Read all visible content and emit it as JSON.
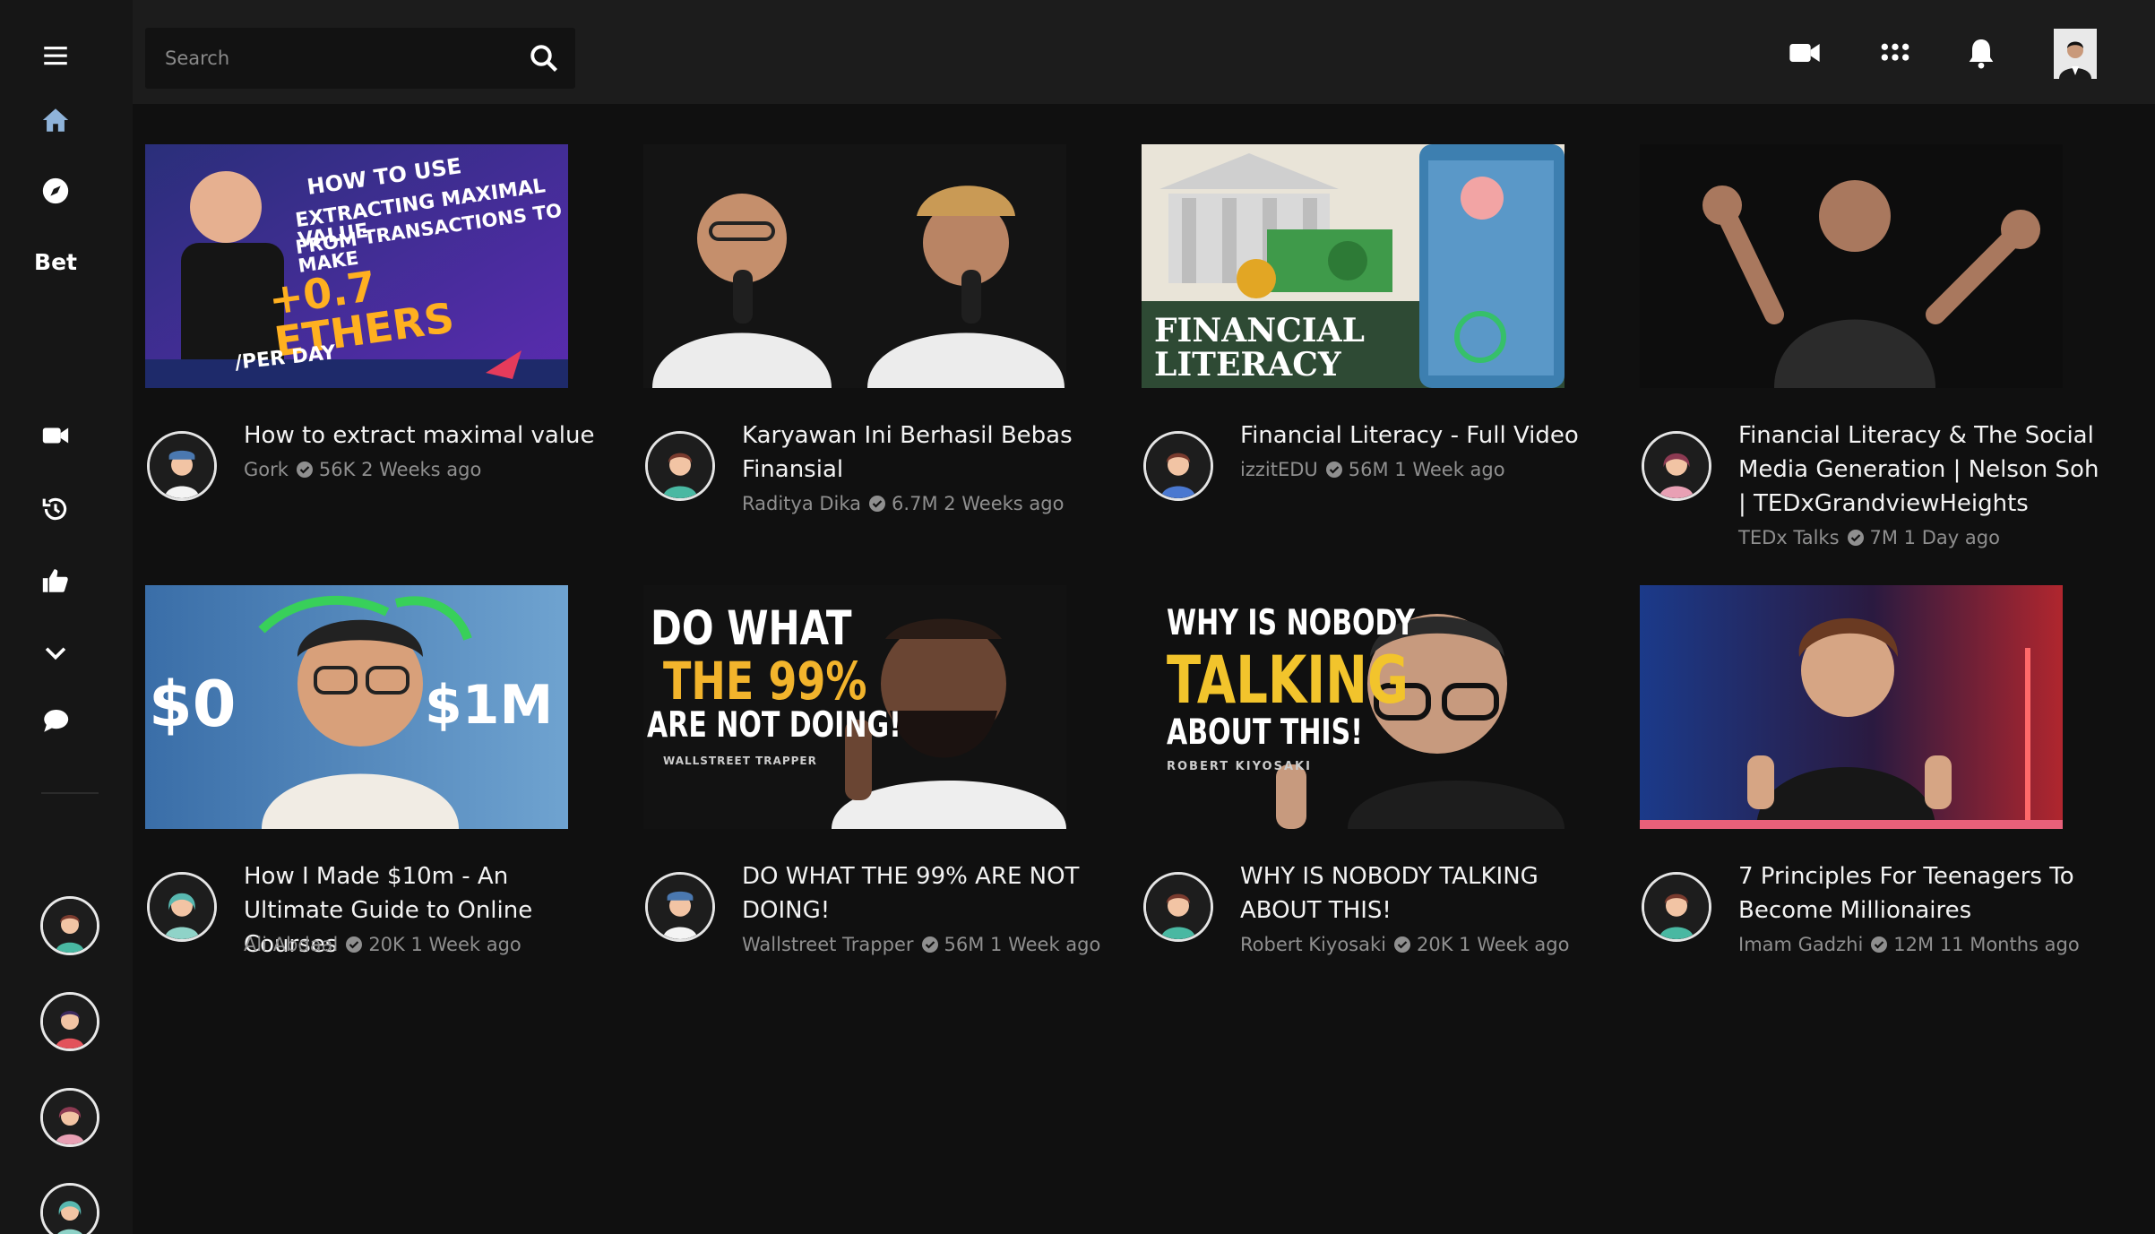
{
  "sidebar": {
    "items": [
      {
        "icon": "hamburger-menu-icon"
      },
      {
        "icon": "home-icon"
      },
      {
        "icon": "compass-icon"
      },
      {
        "label": "Bet"
      },
      {
        "icon": "video-camera-icon"
      },
      {
        "icon": "history-icon"
      },
      {
        "icon": "thumbs-up-icon"
      },
      {
        "icon": "chevron-down-icon"
      },
      {
        "icon": "chat-bubble-icon"
      }
    ],
    "accent_color": "#8fb3d9"
  },
  "search": {
    "placeholder": "Search"
  },
  "topbar": {
    "icons": [
      "video-camera-icon",
      "apps-grid-icon",
      "bell-icon",
      "profile-avatar"
    ]
  },
  "videos": [
    {
      "title": "How to extract maximal value",
      "channel": "Gork",
      "meta": "56K 2 Weeks ago",
      "thumb_text": [
        "HOW TO USE",
        "EXTRACTING MAXIMAL VALUE",
        "FROM TRANSACTIONS TO MAKE",
        "+0.7 ETHERS",
        "/PER DAY"
      ]
    },
    {
      "title": "Karyawan Ini Berhasil Bebas Finansial",
      "channel": "Raditya Dika",
      "meta": "6.7M 2 Weeks ago",
      "thumb_text": []
    },
    {
      "title": "Financial Literacy - Full Video",
      "channel": "izzitEDU",
      "meta": "56M 1 Week ago",
      "thumb_text": [
        "FINANCIAL",
        "LITERACY"
      ]
    },
    {
      "title": "Financial Literacy & The Social Media Generation | Nelson Soh | TEDxGrandviewHeights",
      "channel": "TEDx Talks",
      "meta": "7M 1 Day ago",
      "thumb_text": []
    },
    {
      "title": "How I Made $10m - An Ultimate Guide to Online Courses",
      "channel": "Ali Abdaal",
      "meta": "20K 1 Week ago",
      "thumb_text": [
        "$0",
        "$1M"
      ]
    },
    {
      "title": "DO WHAT THE 99% ARE NOT DOING!",
      "channel": "Wallstreet Trapper",
      "meta": "56M 1 Week ago",
      "thumb_text": [
        "DO WHAT",
        "THE 99%",
        "ARE NOT DOING!",
        "WALLSTREET TRAPPER"
      ]
    },
    {
      "title": "WHY IS NOBODY TALKING ABOUT THIS!",
      "channel": "Robert Kiyosaki",
      "meta": "20K 1 Week ago",
      "thumb_text": [
        "WHY IS NOBODY",
        "TALKING",
        "ABOUT THIS!",
        "ROBERT KIYOSAKI"
      ]
    },
    {
      "title": "7 Principles For Teenagers To Become Millionaires",
      "channel": "Imam Gadzhi",
      "meta": "12M 11 Months ago",
      "thumb_text": []
    }
  ]
}
